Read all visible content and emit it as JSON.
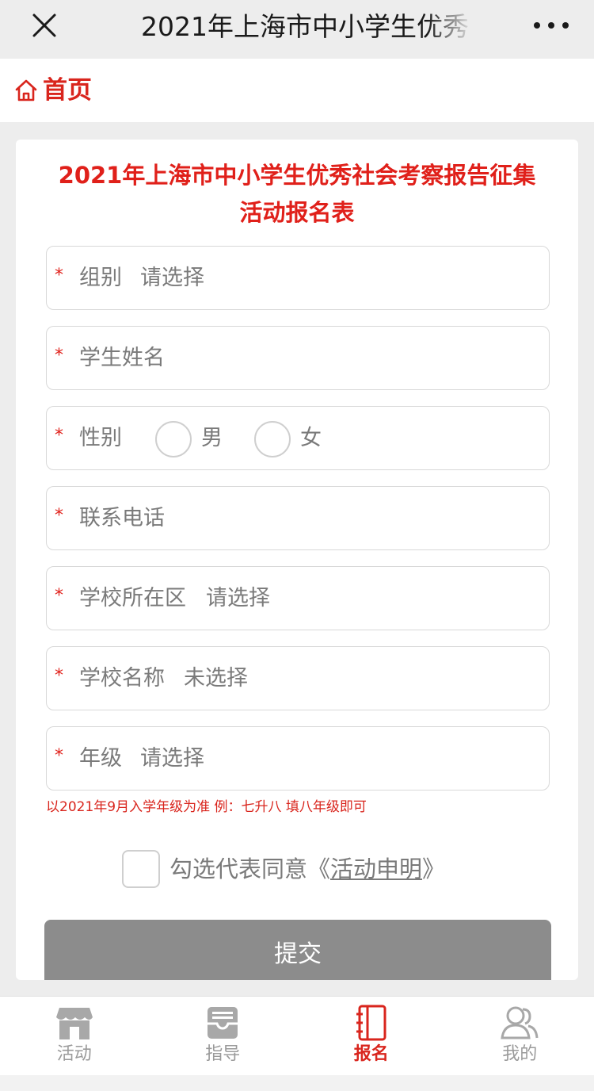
{
  "titlebar": {
    "title": "2021年上海市中小学生优秀",
    "close_icon": "close-icon",
    "more_icon": "more-icon"
  },
  "homebar": {
    "home_label": "首页",
    "home_icon": "home-icon"
  },
  "form": {
    "title_line1": "2021年上海市中小学生优秀社会考察报告征集",
    "title_line2": "活动报名表",
    "required_mark": "*",
    "fields": [
      {
        "label": "组别",
        "hint": "请选择"
      },
      {
        "label": "学生姓名",
        "hint": ""
      },
      {
        "label": "性别",
        "options": [
          "男",
          "女"
        ]
      },
      {
        "label": "联系电话",
        "hint": ""
      },
      {
        "label": "学校所在区",
        "hint": "请选择"
      },
      {
        "label": "学校名称",
        "hint": "未选择"
      },
      {
        "label": "年级",
        "hint": "请选择"
      }
    ],
    "note": "以2021年9月入学年级为准 例：七升八 填八年级即可",
    "agree_text": "勾选代表同意《",
    "agree_link": "活动申明",
    "agree_close": "》",
    "agree_checked": false,
    "submit_label": "提交"
  },
  "tabbar": {
    "tabs": [
      {
        "label": "活动",
        "icon": "store-icon",
        "active": false
      },
      {
        "label": "指导",
        "icon": "inbox-icon",
        "active": false
      },
      {
        "label": "报名",
        "icon": "notebook-icon",
        "active": true
      },
      {
        "label": "我的",
        "icon": "users-icon",
        "active": false
      }
    ]
  },
  "colors": {
    "accent": "#d9251d",
    "submit_bg": "#8c8c8c",
    "page_bg": "#ededed"
  }
}
